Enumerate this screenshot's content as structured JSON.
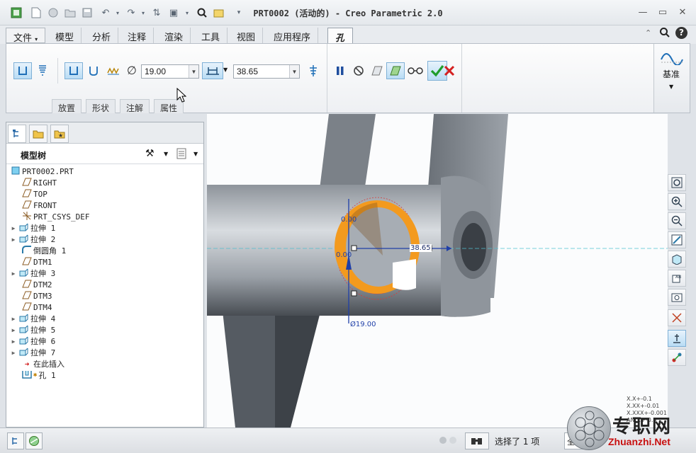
{
  "window": {
    "title": "PRT0002 (活动的) - Creo Parametric 2.0"
  },
  "quick_access": {
    "icons": [
      "app-logo-icon",
      "new-icon",
      "open-icon",
      "save-icon",
      "undo-icon",
      "redo-icon",
      "regenerate-icon",
      "windows-icon",
      "search-icon",
      "close-window-icon",
      "customize-icon"
    ]
  },
  "tabs": [
    {
      "label": "文件"
    },
    {
      "label": "模型"
    },
    {
      "label": "分析"
    },
    {
      "label": "注释"
    },
    {
      "label": "渲染"
    },
    {
      "label": "工具"
    },
    {
      "label": "视图"
    },
    {
      "label": "应用程序"
    },
    {
      "label": "孔"
    }
  ],
  "ribbon": {
    "diameter_value": "19.00",
    "depth_value": "38.65",
    "datum_label": "基准",
    "subtabs": [
      {
        "label": "放置"
      },
      {
        "label": "形状"
      },
      {
        "label": "注解"
      },
      {
        "label": "属性"
      }
    ]
  },
  "model_tree": {
    "header": "模型树",
    "items": [
      {
        "label": "PRT0002.PRT",
        "icon": "part-icon",
        "expandable": false,
        "indent": 0
      },
      {
        "label": "RIGHT",
        "icon": "datum-plane-icon",
        "expandable": false,
        "indent": 1
      },
      {
        "label": "TOP",
        "icon": "datum-plane-icon",
        "expandable": false,
        "indent": 1
      },
      {
        "label": "FRONT",
        "icon": "datum-plane-icon",
        "expandable": false,
        "indent": 1
      },
      {
        "label": "PRT_CSYS_DEF",
        "icon": "csys-icon",
        "expandable": false,
        "indent": 1
      },
      {
        "label": "拉伸 1",
        "icon": "extrude-icon",
        "expandable": true,
        "indent": 1
      },
      {
        "label": "拉伸 2",
        "icon": "extrude-icon",
        "expandable": true,
        "indent": 1
      },
      {
        "label": "倒圆角 1",
        "icon": "round-icon",
        "expandable": false,
        "indent": 1
      },
      {
        "label": "DTM1",
        "icon": "datum-plane-icon",
        "expandable": false,
        "indent": 1
      },
      {
        "label": "拉伸 3",
        "icon": "extrude-icon",
        "expandable": true,
        "indent": 1
      },
      {
        "label": "DTM2",
        "icon": "datum-plane-icon",
        "expandable": false,
        "indent": 1
      },
      {
        "label": "DTM3",
        "icon": "datum-plane-icon",
        "expandable": false,
        "indent": 1
      },
      {
        "label": "DTM4",
        "icon": "datum-plane-icon",
        "expandable": false,
        "indent": 1
      },
      {
        "label": "拉伸 4",
        "icon": "extrude-icon",
        "expandable": true,
        "indent": 1
      },
      {
        "label": "拉伸 5",
        "icon": "extrude-icon",
        "expandable": true,
        "indent": 1
      },
      {
        "label": "拉伸 6",
        "icon": "extrude-icon",
        "expandable": true,
        "indent": 1
      },
      {
        "label": "拉伸 7",
        "icon": "extrude-icon",
        "expandable": true,
        "indent": 1
      },
      {
        "label": "在此插入",
        "icon": "insert-here-icon",
        "expandable": false,
        "indent": 1
      },
      {
        "label": "孔 1",
        "icon": "hole-icon",
        "expandable": false,
        "indent": 1
      }
    ]
  },
  "viewport": {
    "dim_depth": "38.65",
    "dim_diameter": "Ø19.00",
    "dim_a": "0.00",
    "dim_b": "0.00"
  },
  "coord_readout": {
    "line1": "X.X+-0.1",
    "line2": "X.XX+-0.01",
    "line3": "X.XXX+-0.001",
    "line4": "ANG.+-0.5"
  },
  "status_bar": {
    "selection_text": "选择了 1 项",
    "filter_text": "全部"
  },
  "watermark": {
    "brand": "专职网",
    "url": "Zhuanzhi.Net"
  },
  "colors": {
    "accent": "#2a8fd6",
    "hole_orange": "#f39a1e",
    "confirm_green": "#1f9d2a",
    "cancel_red": "#d42020"
  }
}
